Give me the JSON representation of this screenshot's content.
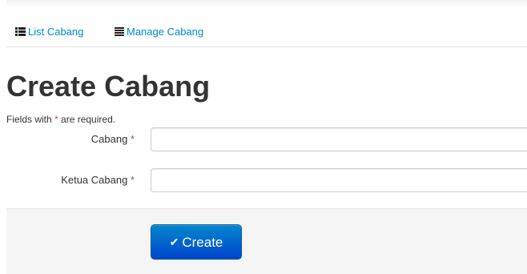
{
  "nav": {
    "list_label": "List Cabang",
    "manage_label": "Manage Cabang"
  },
  "page": {
    "title": "Create Cabang"
  },
  "note": {
    "prefix": "Fields with ",
    "asterisk": "*",
    "suffix": " are required."
  },
  "form": {
    "fields": [
      {
        "label": "Cabang",
        "required_mark": "*",
        "value": "",
        "placeholder": ""
      },
      {
        "label": "Ketua Cabang",
        "required_mark": "*",
        "value": "",
        "placeholder": ""
      }
    ],
    "submit": {
      "icon": "check-icon",
      "label": "Create"
    }
  },
  "colors": {
    "link": "#0088cc",
    "required": "#b94a48",
    "primary_button_top": "#0088cc",
    "primary_button_bottom": "#0044cc"
  }
}
